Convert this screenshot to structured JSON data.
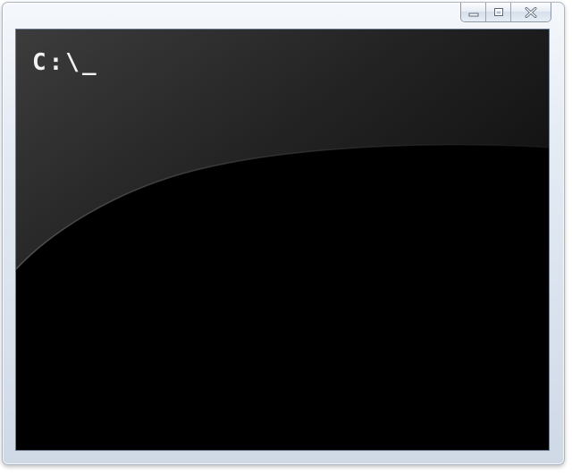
{
  "window": {
    "caption_buttons": [
      {
        "name": "minimize-icon"
      },
      {
        "name": "maximize-icon"
      },
      {
        "name": "close-icon"
      }
    ]
  },
  "console": {
    "prompt": "C:\\_"
  },
  "colors": {
    "console_background": "#000000",
    "console_text": "#f2f2f2",
    "frame": "#dce4ef"
  }
}
